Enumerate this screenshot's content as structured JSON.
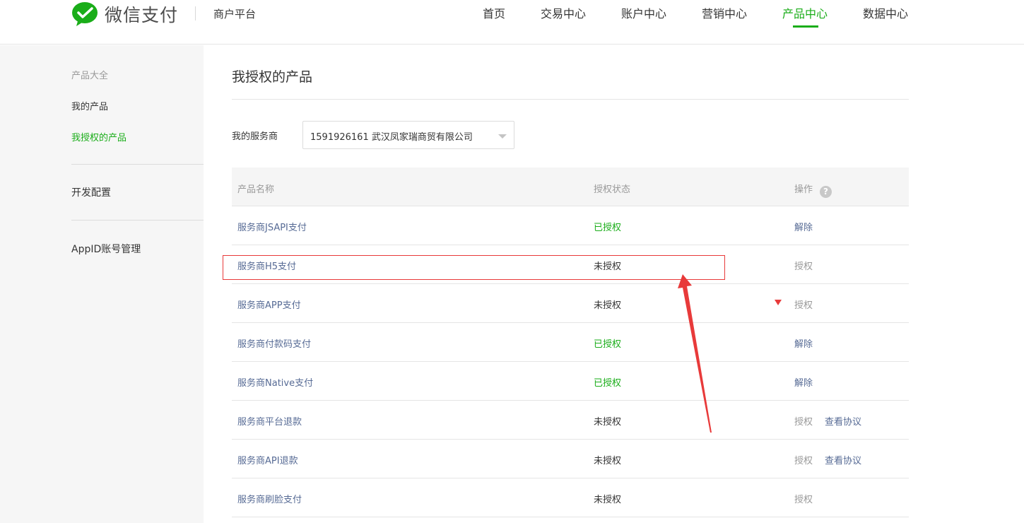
{
  "brand": {
    "name": "微信支付",
    "platform": "商户平台",
    "accent": "#1aad19"
  },
  "nav": {
    "items": [
      {
        "label": "首页"
      },
      {
        "label": "交易中心"
      },
      {
        "label": "账户中心"
      },
      {
        "label": "营销中心"
      },
      {
        "label": "产品中心",
        "active": true
      },
      {
        "label": "数据中心"
      }
    ]
  },
  "sidebar": {
    "section_title": "产品大全",
    "items": [
      {
        "label": "我的产品"
      },
      {
        "label": "我授权的产品",
        "active": true
      }
    ],
    "dev_config": "开发配置",
    "appid_manage": "AppID账号管理"
  },
  "page": {
    "title": "我授权的产品",
    "filter_label": "我的服务商",
    "filter_value": "1591926161 武汉凤家瑞商贸有限公司"
  },
  "table": {
    "headers": {
      "name": "产品名称",
      "status": "授权状态",
      "op": "操作"
    },
    "rows": [
      {
        "name": "服务商JSAPI支付",
        "status": "已授权",
        "op": "解除",
        "op2": ""
      },
      {
        "name": "服务商H5支付",
        "status": "未授权",
        "op": "授权",
        "op2": ""
      },
      {
        "name": "服务商APP支付",
        "status": "未授权",
        "op": "授权",
        "op2": ""
      },
      {
        "name": "服务商付款码支付",
        "status": "已授权",
        "op": "解除",
        "op2": ""
      },
      {
        "name": "服务商Native支付",
        "status": "已授权",
        "op": "解除",
        "op2": ""
      },
      {
        "name": "服务商平台退款",
        "status": "未授权",
        "op": "授权",
        "op2": "查看协议"
      },
      {
        "name": "服务商API退款",
        "status": "未授权",
        "op": "授权",
        "op2": "查看协议"
      },
      {
        "name": "服务商刷脸支付",
        "status": "未授权",
        "op": "授权",
        "op2": ""
      }
    ]
  },
  "annotation": {
    "color": "#e83a3a"
  }
}
